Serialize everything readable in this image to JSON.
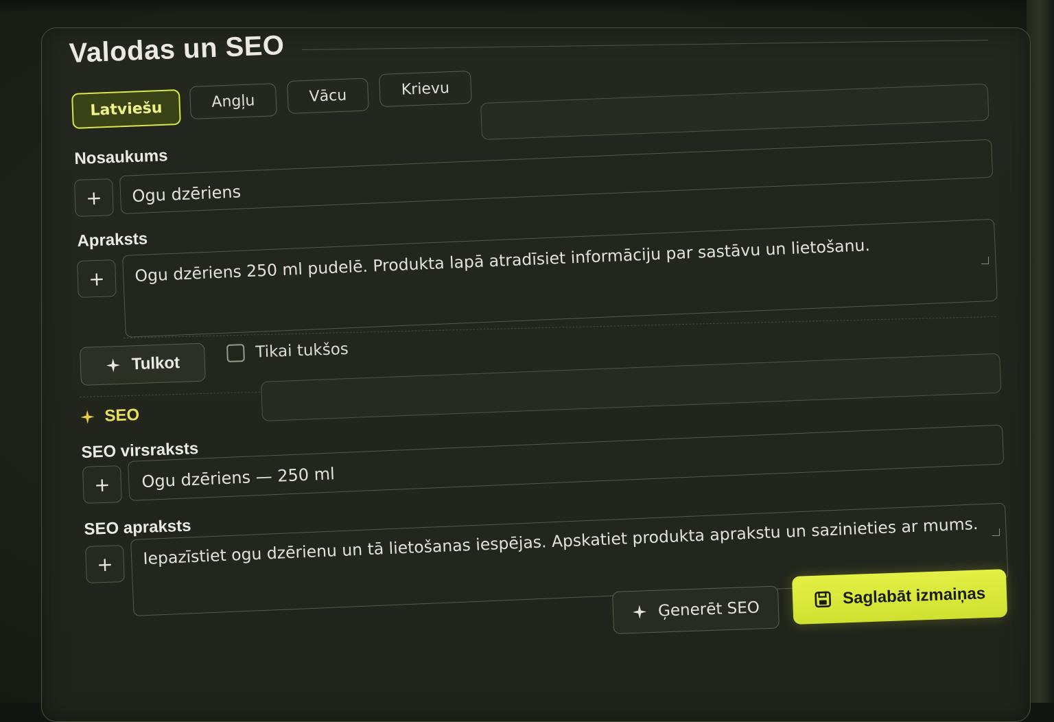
{
  "header": {
    "title": "Valodas un SEO"
  },
  "tabs": [
    {
      "label": "Latviešu",
      "active": true
    },
    {
      "label": "Angļu",
      "active": false
    },
    {
      "label": "Vācu",
      "active": false
    },
    {
      "label": "Krievu",
      "active": false
    }
  ],
  "fields": {
    "name": {
      "label": "Nosaukums",
      "value": "Ogu dzēriens"
    },
    "description": {
      "label": "Apraksts",
      "value": "Ogu dzēriens 250 ml pudelē. Produkta lapā atradīsiet informāciju par sastāvu un lietošanu."
    }
  },
  "translate": {
    "button_label": "Tulkot",
    "only_empty_label": "Tikai tukšos",
    "only_empty_checked": false
  },
  "seo": {
    "heading": "SEO",
    "title": {
      "label": "SEO virsraksts",
      "value": "Ogu dzēriens — 250 ml"
    },
    "description": {
      "label": "SEO apraksts",
      "value": "Iepazīstiet ogu dzērienu un tā lietošanas iespējas. Apskatiet produkta aprakstu un sazinieties ar mums."
    }
  },
  "actions": {
    "generate_label": "Ģenerēt SEO",
    "save_label": "Saglabāt izmaiņas"
  },
  "icons": {
    "add": "plus-icon",
    "sparkle": "sparkle-icon",
    "save": "save-icon",
    "resize": "resize-grip-icon"
  },
  "colors": {
    "accent": "#d8e84a",
    "accent_text": "#e8e05a",
    "background": "#23271e",
    "text": "#ecebe2"
  }
}
